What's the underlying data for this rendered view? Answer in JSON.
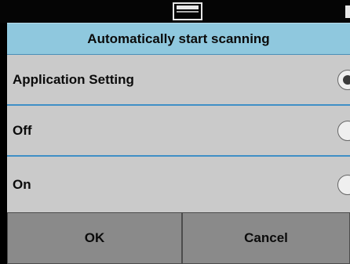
{
  "topbar": {
    "center_icon": "scanner-tray-icon",
    "corner_icon": "status-icon"
  },
  "dialog": {
    "title": "Automatically start scanning",
    "options": [
      {
        "label": "Application Setting",
        "selected": true
      },
      {
        "label": "Off",
        "selected": false
      },
      {
        "label": "On",
        "selected": false
      }
    ],
    "ok_label": "OK",
    "cancel_label": "Cancel"
  },
  "colors": {
    "header_bg": "#8fc8de",
    "option_bg": "#cacaca",
    "divider": "#3f8fc6",
    "button_bg": "#8a8a8a"
  }
}
